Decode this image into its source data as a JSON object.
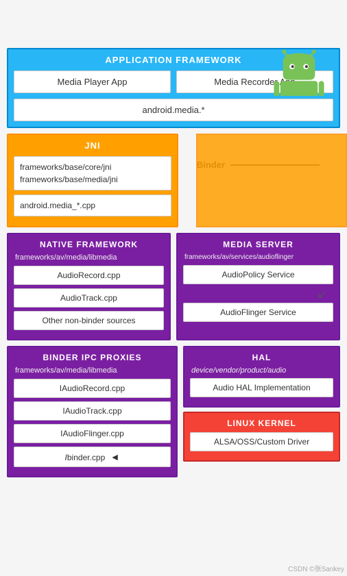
{
  "android_logo": {
    "color": "#78C257",
    "accent": "#4CAF50"
  },
  "app_framework": {
    "title": "APPLICATION FRAMEWORK",
    "media_player": "Media Player App",
    "media_recorder": "Media Recorder App",
    "android_media": "android.media.*"
  },
  "jni": {
    "title": "JNI",
    "frameworks_core": "frameworks/base/core/jni\nframeworks/base/media/jni",
    "android_media_cpp": "android.media_*.cpp"
  },
  "binder": {
    "label": "Binder"
  },
  "native_framework": {
    "title": "NATIVE FRAMEWORK",
    "path": "frameworks/av/media/libmedia",
    "items": [
      "AudioRecord.cpp",
      "AudioTrack.cpp",
      "Other non-binder sources"
    ]
  },
  "media_server": {
    "title": "MEDIA SERVER",
    "path": "frameworks/av/services/audioflinger",
    "items": [
      "AudioPolicy Service",
      "AudioFlinger Service"
    ]
  },
  "binder_ipc": {
    "title": "BINDER IPC PROXIES",
    "path": "frameworks/av/media/libmedia",
    "items": [
      "IAudioRecord.cpp",
      "IAudioTrack.cpp",
      "IAudioFlinger.cpp",
      "Ibinder.cpp"
    ]
  },
  "hal": {
    "title": "HAL",
    "path": "device/vendor/product/audio",
    "item": "Audio HAL Implementation"
  },
  "linux_kernel": {
    "title": "LINUX KERNEL",
    "item": "ALSA/OSS/Custom Driver"
  },
  "watermark": "CSDN ©张Sankey"
}
